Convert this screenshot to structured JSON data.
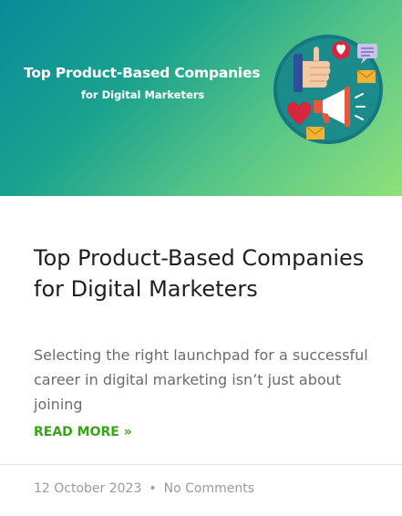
{
  "hero": {
    "title": "Top Product-Based Companies",
    "subtitle": "for Digital Marketers",
    "art_icons": [
      "thumbs-up-icon",
      "heart-icon",
      "chat-bubble-icon",
      "envelope-icon",
      "megaphone-icon"
    ]
  },
  "post": {
    "title": "Top Product-Based Companies for Digital Marketers",
    "excerpt": "Selecting the right launchpad for a successful career in digital marketing isn’t just about joining",
    "read_more": "READ MORE »"
  },
  "meta": {
    "date": "12 October 2023",
    "separator": "•",
    "comments": "No Comments"
  },
  "colors": {
    "accent": "#37a514",
    "title_text": "#1f1f1f",
    "body_text": "#6b6b6b",
    "meta_text": "#9a9a9a",
    "hero_gradient_start": "#0a8a9a",
    "hero_gradient_end": "#8fe07a"
  }
}
